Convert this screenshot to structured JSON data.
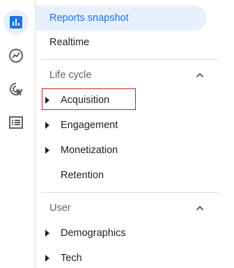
{
  "rail": {
    "items": [
      {
        "icon": "reports-bar-chart-icon",
        "active": true
      },
      {
        "icon": "explore-chart-icon",
        "active": false
      },
      {
        "icon": "advertising-cursor-icon",
        "active": false
      },
      {
        "icon": "configure-list-icon",
        "active": false
      }
    ]
  },
  "nav": {
    "snapshot_label": "Reports snapshot",
    "realtime_label": "Realtime",
    "lifecycle": {
      "title": "Life cycle",
      "items": [
        {
          "label": "Acquisition",
          "expandable": true
        },
        {
          "label": "Engagement",
          "expandable": true
        },
        {
          "label": "Monetization",
          "expandable": true
        },
        {
          "label": "Retention",
          "expandable": false
        }
      ]
    },
    "user": {
      "title": "User",
      "items": [
        {
          "label": "Demographics",
          "expandable": true
        },
        {
          "label": "Tech",
          "expandable": true
        }
      ]
    }
  },
  "colors": {
    "accent": "#1a73e8",
    "selected_bg": "#e8f0fe",
    "highlight_border": "#c5221f"
  }
}
